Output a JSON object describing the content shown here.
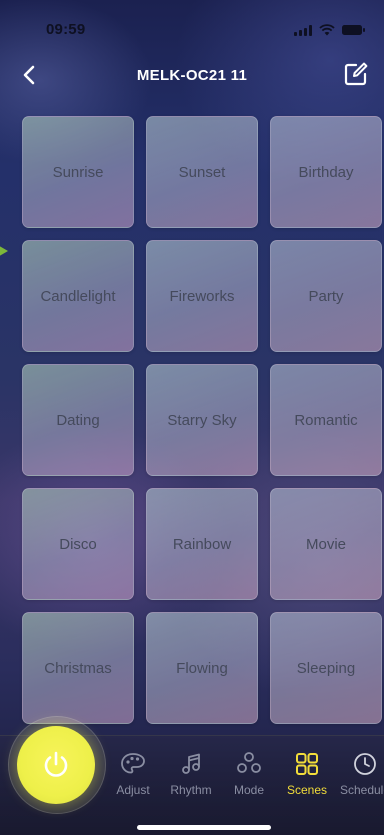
{
  "status_bar": {
    "time": "09:59"
  },
  "header": {
    "title": "MELK-OC21  11"
  },
  "scenes": [
    {
      "label": "Sunrise"
    },
    {
      "label": "Sunset"
    },
    {
      "label": "Birthday"
    },
    {
      "label": "Candlelight"
    },
    {
      "label": "Fireworks"
    },
    {
      "label": "Party"
    },
    {
      "label": "Dating"
    },
    {
      "label": "Starry Sky"
    },
    {
      "label": "Romantic"
    },
    {
      "label": "Disco"
    },
    {
      "label": "Rainbow"
    },
    {
      "label": "Movie"
    },
    {
      "label": "Christmas"
    },
    {
      "label": "Flowing"
    },
    {
      "label": "Sleeping"
    }
  ],
  "tabs": [
    {
      "label": "Adjust",
      "icon": "palette-icon"
    },
    {
      "label": "Rhythm",
      "icon": "music-notes-icon"
    },
    {
      "label": "Mode",
      "icon": "mode-circles-icon"
    },
    {
      "label": "Scenes",
      "icon": "grid-icon",
      "active": true
    },
    {
      "label": "Schedule",
      "icon": "clock-icon"
    }
  ],
  "colors": {
    "accent": "#f2dd3a",
    "power_button": "#eef04a",
    "tab_inactive": "#8a8ea2",
    "marker": "#7db83a"
  }
}
